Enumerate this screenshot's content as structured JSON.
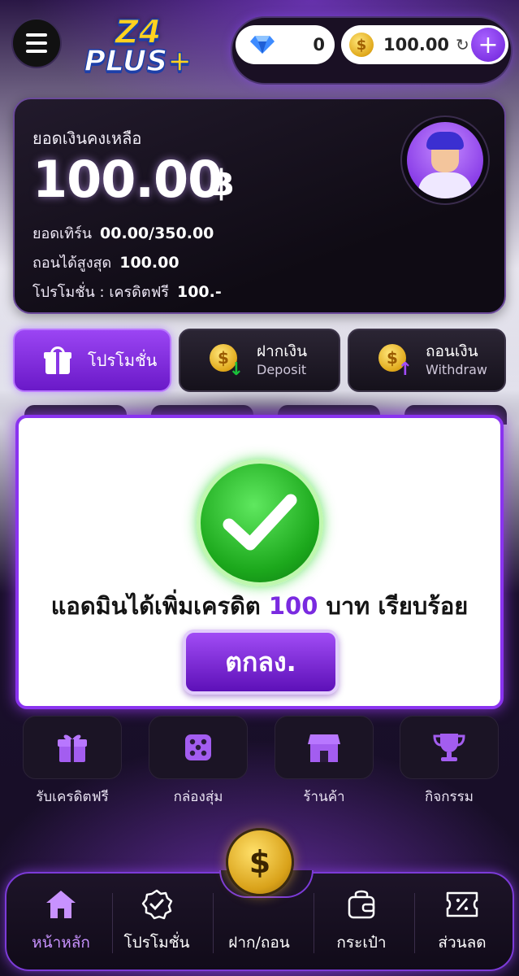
{
  "header": {
    "logo_line1": "Z4",
    "logo_line2": "PLUS",
    "logo_plus": "+",
    "gem_count": "0",
    "coin_balance": "100.00",
    "colors": {
      "accent": "#8a33f0",
      "gold": "#e0a81a",
      "success": "#1ca81c"
    }
  },
  "balance_card": {
    "label": "ยอดเงินคงเหลือ",
    "amount": "100.00",
    "currency": "฿",
    "turnover_label": "ยอดเทิร์น",
    "turnover_value": "00.00/350.00",
    "max_withdraw_label": "ถอนได้สูงสุด",
    "max_withdraw_value": "100.00",
    "promotion_label": "โปรโมชั่น : เครดิตฟรี",
    "promotion_value": "100.-"
  },
  "actions": {
    "promo_label": "โปรโมชั่น",
    "deposit_th": "ฝากเงิน",
    "deposit_en": "Deposit",
    "withdraw_th": "ถอนเงิน",
    "withdraw_en": "Withdraw"
  },
  "modal": {
    "message_before": "แอดมินได้เพิ่มเครดิต ",
    "message_amount": "100",
    "message_after": " บาท เรียบร้อย",
    "ok_label": "ตกลง."
  },
  "quick_menu": [
    {
      "label": "รับเครดิตฟรี",
      "icon": "gift-icon"
    },
    {
      "label": "กล่องสุ่ม",
      "icon": "dice-icon"
    },
    {
      "label": "ร้านค้า",
      "icon": "shop-icon"
    },
    {
      "label": "กิจกรรม",
      "icon": "trophy-icon"
    }
  ],
  "bottom_nav": [
    {
      "label": "หน้าหลัก",
      "icon": "home-icon",
      "active": true
    },
    {
      "label": "โปรโมชั่น",
      "icon": "badge-check-icon"
    },
    {
      "label": "ฝาก/ถอน",
      "icon": "coin-exchange-icon"
    },
    {
      "label": "กระเป๋า",
      "icon": "wallet-icon"
    },
    {
      "label": "ส่วนลด",
      "icon": "discount-ticket-icon"
    }
  ]
}
